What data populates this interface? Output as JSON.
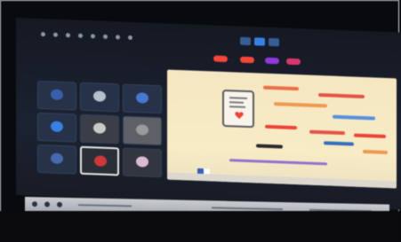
{
  "window": {
    "title": ""
  },
  "toolbar": {
    "icons": [
      "menu-icon",
      "camera-icon",
      "mic-icon",
      "share-icon",
      "record-icon",
      "chat-icon",
      "people-icon",
      "settings-icon"
    ],
    "status_pills": [
      "#e84a3c",
      "#e84a3c",
      "#8e3ad1",
      "#cf3a6b"
    ]
  },
  "participants": [
    {
      "label": "",
      "icon": "avatar-icon"
    },
    {
      "label": "",
      "icon": "video-icon"
    },
    {
      "label": "",
      "icon": "video-icon"
    },
    {
      "label": "",
      "icon": "avatar-icon"
    },
    {
      "label": "",
      "icon": "video-icon"
    },
    {
      "label": "",
      "icon": "video-icon"
    },
    {
      "label": "",
      "icon": "avatar-icon"
    },
    {
      "label": "",
      "icon": "video-icon"
    },
    {
      "label": "",
      "icon": "video-icon"
    }
  ],
  "slide": {
    "words": [
      "",
      "",
      "",
      "",
      "",
      ""
    ]
  },
  "colors": {
    "accent_blue": "#3f7fd9",
    "accent_red": "#e0483b",
    "slide_background": "#f4e8c6"
  }
}
